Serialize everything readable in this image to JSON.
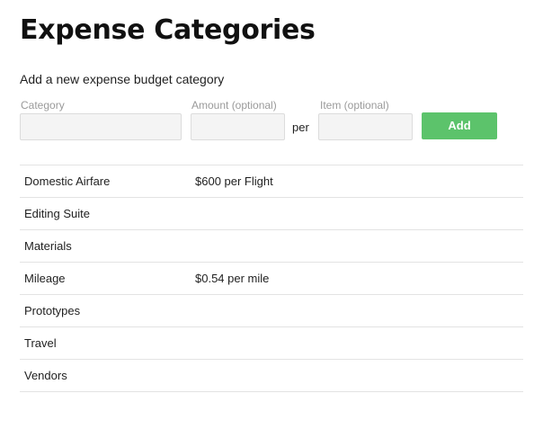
{
  "page": {
    "title": "Expense Categories",
    "subtitle": "Add a new expense budget category"
  },
  "form": {
    "category_label": "Category",
    "category_value": "",
    "category_placeholder": "",
    "amount_label": "Amount (optional)",
    "amount_value": "",
    "amount_placeholder": "",
    "per_text": "per",
    "item_label": "Item (optional)",
    "item_value": "",
    "item_placeholder": "",
    "add_label": "Add",
    "add_color": "#5cc36b"
  },
  "categories": [
    {
      "name": "Domestic Airfare",
      "amount": "$600 per Flight"
    },
    {
      "name": "Editing Suite",
      "amount": ""
    },
    {
      "name": "Materials",
      "amount": ""
    },
    {
      "name": "Mileage",
      "amount": "$0.54 per mile"
    },
    {
      "name": "Prototypes",
      "amount": ""
    },
    {
      "name": "Travel",
      "amount": ""
    },
    {
      "name": "Vendors",
      "amount": ""
    }
  ]
}
